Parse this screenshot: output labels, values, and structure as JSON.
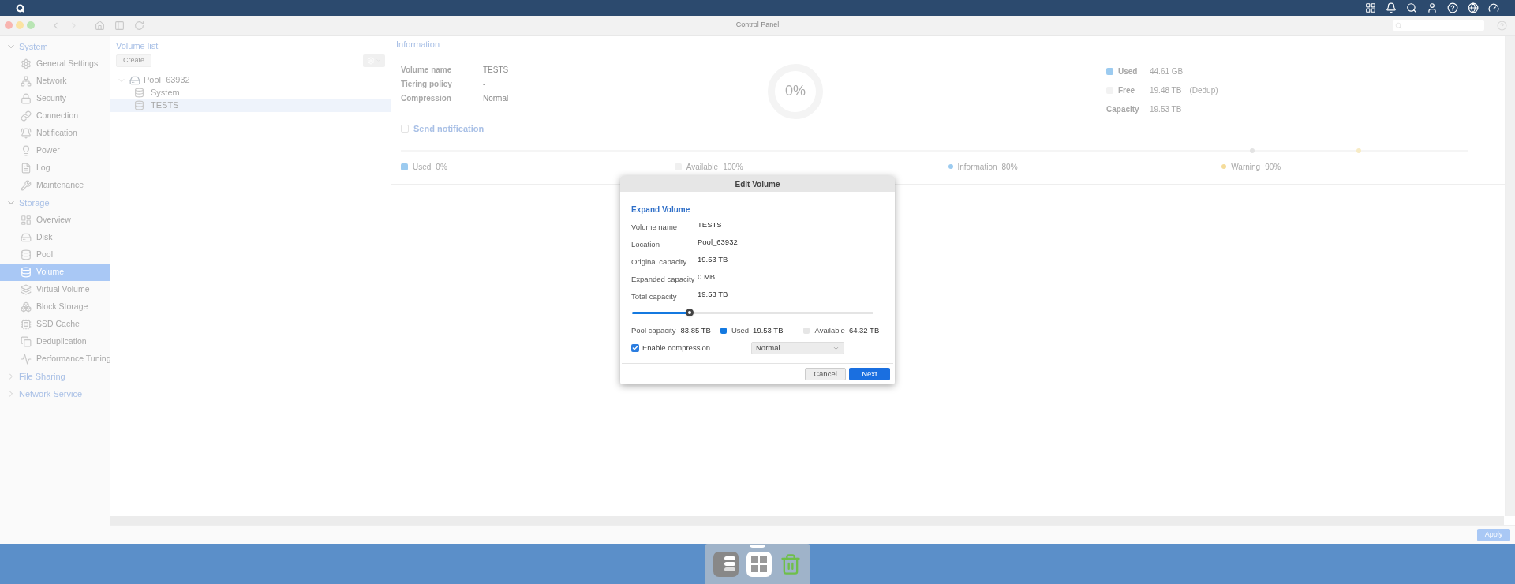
{
  "window": {
    "title": "Control Panel"
  },
  "sidebar": {
    "groups": [
      {
        "label": "System",
        "expanded": true,
        "items": [
          {
            "label": "General Settings",
            "selected": false
          },
          {
            "label": "Network",
            "selected": false
          },
          {
            "label": "Security",
            "selected": false
          },
          {
            "label": "Connection",
            "selected": false
          },
          {
            "label": "Notification",
            "selected": false
          },
          {
            "label": "Power",
            "selected": false
          },
          {
            "label": "Log",
            "selected": false
          },
          {
            "label": "Maintenance",
            "selected": false
          }
        ]
      },
      {
        "label": "Storage",
        "expanded": true,
        "items": [
          {
            "label": "Overview",
            "selected": false
          },
          {
            "label": "Disk",
            "selected": false
          },
          {
            "label": "Pool",
            "selected": false
          },
          {
            "label": "Volume",
            "selected": true
          },
          {
            "label": "Virtual Volume",
            "selected": false
          },
          {
            "label": "Block Storage",
            "selected": false
          },
          {
            "label": "SSD Cache",
            "selected": false
          },
          {
            "label": "Deduplication",
            "selected": false
          },
          {
            "label": "Performance Tuning",
            "selected": false
          }
        ]
      },
      {
        "label": "File Sharing",
        "expanded": false
      },
      {
        "label": "Network Service",
        "expanded": false
      }
    ]
  },
  "volume_list": {
    "title": "Volume list",
    "create_button": "Create",
    "tree": [
      {
        "label": "Pool_63932",
        "expanded": true,
        "children": [
          {
            "label": "System",
            "selected": false
          },
          {
            "label": "TESTS",
            "selected": true
          }
        ]
      }
    ]
  },
  "information": {
    "title": "Information",
    "fields": [
      {
        "label": "Volume name",
        "value": "TESTS"
      },
      {
        "label": "Tiering policy",
        "value": "-"
      },
      {
        "label": "Compression",
        "value": "Normal"
      }
    ],
    "donut_label": "0%",
    "usage": [
      {
        "label": "Used",
        "value": "44.61 GB",
        "color": "#9ccbf0"
      },
      {
        "label": "Free",
        "value": "19.48 TB",
        "note": "(Dedup)",
        "color": "#f2f2f2"
      },
      {
        "label": "Capacity",
        "value": "19.53 TB"
      }
    ],
    "send_notification": {
      "label": "Send notification",
      "checked": false
    },
    "thresholds": [
      {
        "label": "Used",
        "value": "0%",
        "color": "#9ccbf0"
      },
      {
        "label": "Available",
        "value": "100%",
        "color": "#f0f0f0"
      },
      {
        "label": "Information",
        "value": "80%",
        "color": "#9ccbf0"
      },
      {
        "label": "Warning",
        "value": "90%",
        "color": "#f5dc9a"
      }
    ]
  },
  "apply_button": {
    "label": "Apply",
    "disabled": true
  },
  "dialog": {
    "title": "Edit Volume",
    "section": "Expand Volume",
    "fields": [
      {
        "label": "Volume name",
        "value": "TESTS"
      },
      {
        "label": "Location",
        "value": "Pool_63932"
      },
      {
        "label": "Original capacity",
        "value": "19.53 TB"
      },
      {
        "label": "Expanded capacity",
        "value": "0 MB"
      },
      {
        "label": "Total capacity",
        "value": "19.53 TB"
      }
    ],
    "slider": {
      "level": 0.24
    },
    "pool_capacity": {
      "label": "Pool capacity",
      "value": "83.85 TB"
    },
    "legend": [
      {
        "label": "Used",
        "value": "19.53 TB",
        "color": "#1479e0"
      },
      {
        "label": "Available",
        "value": "64.32 TB",
        "color": "#e6e6e6"
      }
    ],
    "compression": {
      "label": "Enable compression",
      "checked": true,
      "select_value": "Normal"
    },
    "buttons": [
      {
        "label": "Cancel",
        "kind": "secondary"
      },
      {
        "label": "Next",
        "kind": "primary"
      }
    ]
  }
}
